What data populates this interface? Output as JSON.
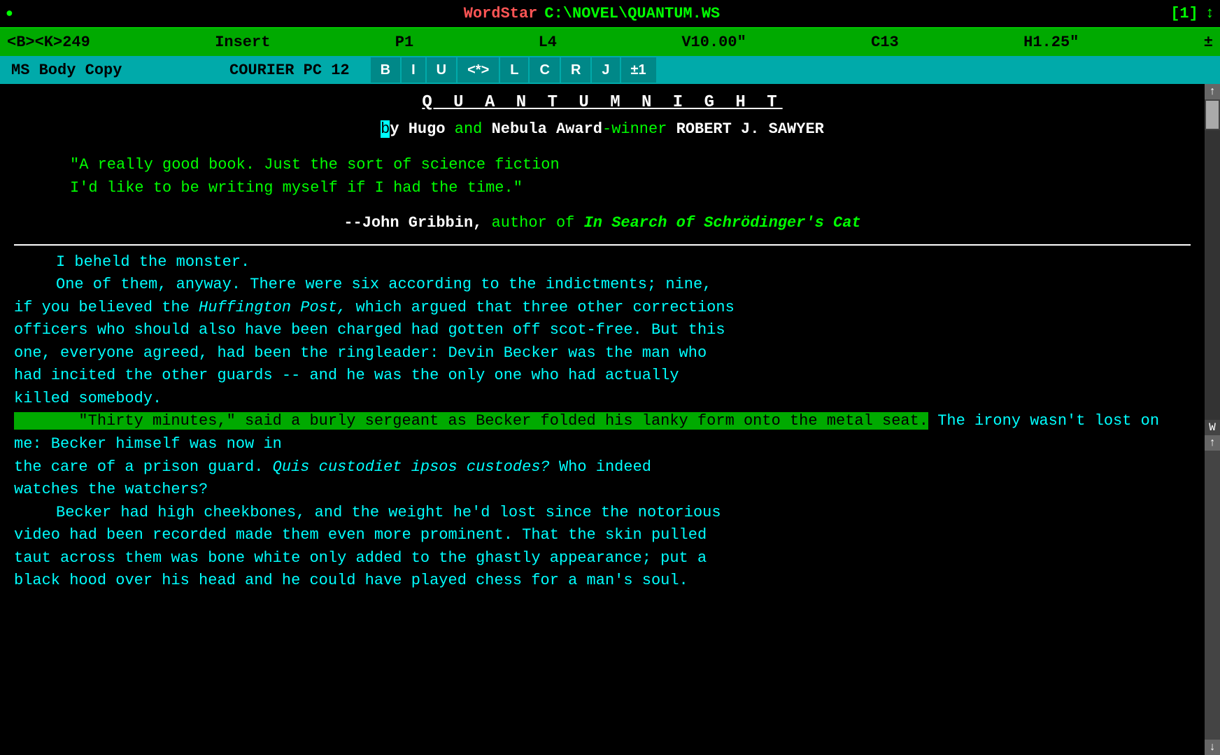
{
  "titlebar": {
    "dot": "●",
    "app_name": "WordStar",
    "file_path": "C:\\NOVEL\\QUANTUM.WS",
    "page_indicator": "[1]",
    "arrow": "↕"
  },
  "statusbar": {
    "cursor_pos": "<B><K>249",
    "insert": "Insert",
    "page": "P1",
    "line": "L4",
    "version": "V10.00\"",
    "col": "C13",
    "horiz": "H1.25\"",
    "plus_minus": "±"
  },
  "formatbar": {
    "style": "MS Body Copy",
    "font": "COURIER PC 12",
    "buttons": [
      "B",
      "I",
      "U",
      "<*>",
      "L",
      "C",
      "R",
      "J",
      "±1"
    ]
  },
  "content": {
    "title": "Q U A N T U M   N I G H T",
    "byline_cursor": "b",
    "byline_by": "y",
    "byline_middle": "Hugo",
    "byline_and": "and",
    "byline_award": "Nebula Award",
    "byline_dash": "-winner",
    "byline_author": "ROBERT J. SAWYER",
    "quote1": "\"A really good book.  Just the sort of science fiction",
    "quote2": "I'd like to be writing myself if I had the time.\"",
    "attribution_dash": "--",
    "attribution_name": "John Gribbin,",
    "attribution_word": "author",
    "attribution_of": "of",
    "attribution_book": "In Search of Schrödinger's Cat",
    "hr": true,
    "para1": "I beheld the monster.",
    "para2_1": "One of them, anyway.  There were six according to the indictments; nine,",
    "para2_2": "if you believed the ",
    "para2_huffington": "Huffington Post,",
    "para2_3": " which argued that three other corrections",
    "para2_4": "officers who should also have been charged had gotten off scot-free.  But this",
    "para2_5": "one, everyone agreed, had been the ringleader: Devin Becker was the man who",
    "para2_6": "had incited the other guards -- and he was the only one who had actually",
    "para2_7": "killed somebody.",
    "highlight1": "\"Thirty minutes,\" said a burly sergeant as Becker folded his lanky form",
    "highlight2": "onto the metal seat.",
    "para3_rest": " The irony wasn't lost on me: Becker himself was now in",
    "para3_2": "the care of a prison guard.",
    "para3_latin": "  Quis custodiet ipsos custodes?",
    "para3_3": "  Who indeed",
    "para3_4": "watches the watchers?",
    "para4_1": "Becker had high cheekbones, and the weight he'd lost since the notorious",
    "para4_2": "video had been recorded made them even more prominent.  That the skin pulled",
    "para4_3": "taut across them was bone white only added to the ghastly appearance; put a",
    "para4_4": "black hood over his head and he could have played chess for a man's soul.",
    "scrollbar": {
      "up_arrow": "↑",
      "down_arrow": "↓",
      "w_marker": "W",
      "up_arrow2": "↑",
      "down_arrow2": "↓"
    }
  }
}
